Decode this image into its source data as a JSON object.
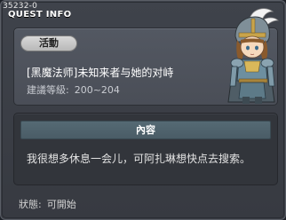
{
  "window": {
    "quest_id": "35232-0",
    "title": "QUEST INFO"
  },
  "info": {
    "category": "活動",
    "quest_name": "[黑魔法师]未知来者与她的对峙",
    "level_label": "建議等級:",
    "level_value": "200~204",
    "portrait_icon": "npc-knight-portrait"
  },
  "content": {
    "header": "內容",
    "text": "我很想多休息一会儿，可阿扎琳想快点去搜索。"
  },
  "status": {
    "label": "狀態:",
    "value": "可開始"
  }
}
